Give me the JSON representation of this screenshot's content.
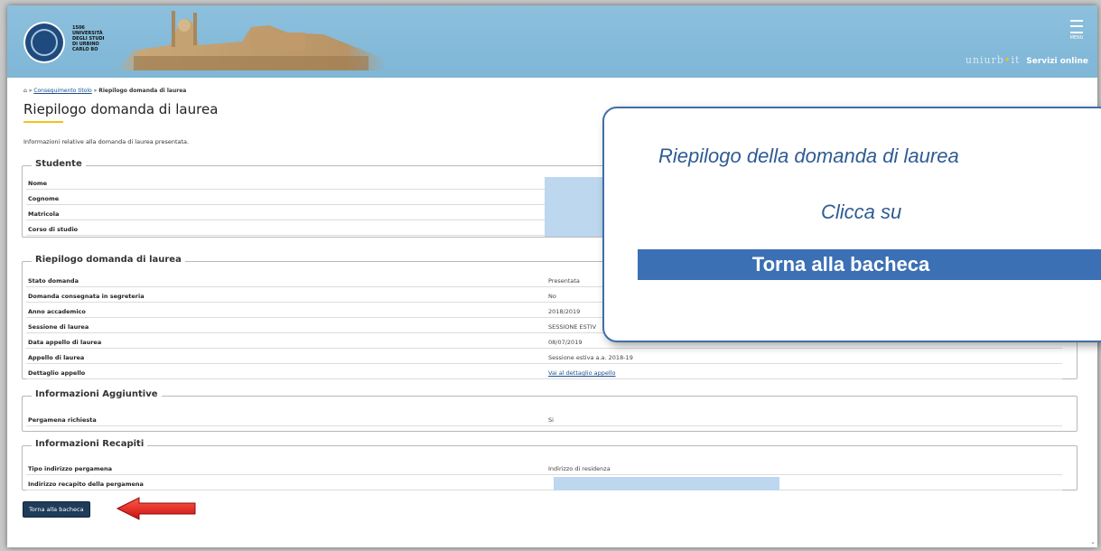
{
  "header": {
    "university": "1506\nUNIVERSITÀ\nDEGLI STUDI\nDI URBINO\nCARLO BO",
    "menu_label": "MENU",
    "brand": "uniurb",
    "brand_suffix": "it",
    "servizi_online": "Servizi online"
  },
  "breadcrumb": {
    "home_icon": "home-icon",
    "link": "Conseguimento titolo",
    "separator": " » ",
    "current": "Riepilogo domanda di laurea"
  },
  "page": {
    "title": "Riepilogo domanda di laurea",
    "intro": "Informazioni relative alla domanda di laurea presentata."
  },
  "studente": {
    "title": "Studente",
    "rows": [
      {
        "label": "Nome",
        "value": ""
      },
      {
        "label": "Cognome",
        "value": ""
      },
      {
        "label": "Matricola",
        "value": ""
      },
      {
        "label": "Corso di studio",
        "value": ""
      }
    ]
  },
  "riepilogo": {
    "title": "Riepilogo domanda di laurea",
    "rows": [
      {
        "label": "Stato domanda",
        "value": "Presentata"
      },
      {
        "label": "Domanda consegnata in segreteria",
        "value": "No"
      },
      {
        "label": "Anno accademico",
        "value": "2018/2019"
      },
      {
        "label": "Sessione di laurea",
        "value": "SESSIONE ESTIV"
      },
      {
        "label": "Data appello di laurea",
        "value": "08/07/2019"
      },
      {
        "label": "Appello di laurea",
        "value": "Sessione estiva a.a. 2018-19"
      },
      {
        "label": "Dettaglio appello",
        "value": "Vai al dettaglio appello"
      }
    ]
  },
  "aggiuntive": {
    "title": "Informazioni Aggiuntive",
    "rows": [
      {
        "label": "Pergamena richiesta",
        "value": "Si"
      }
    ]
  },
  "recapiti": {
    "title": "Informazioni Recapiti",
    "rows": [
      {
        "label": "Tipo indirizzo pergamena",
        "value": "Indirizzo di residenza"
      },
      {
        "label": "Indirizzo recapito della pergamena",
        "value": ""
      }
    ]
  },
  "back_button": "Torna alla bacheca",
  "callout": {
    "line1": "Riepilogo della domanda di laurea",
    "line2": "Clicca su",
    "highlight": "Torna alla bacheca"
  },
  "colors": {
    "header_bg": "#8cc0dd",
    "accent_yellow": "#f0c419",
    "button_bg": "#1f3c5a",
    "callout_blue": "#3c70b4",
    "arrow_red": "#e31b1b"
  }
}
